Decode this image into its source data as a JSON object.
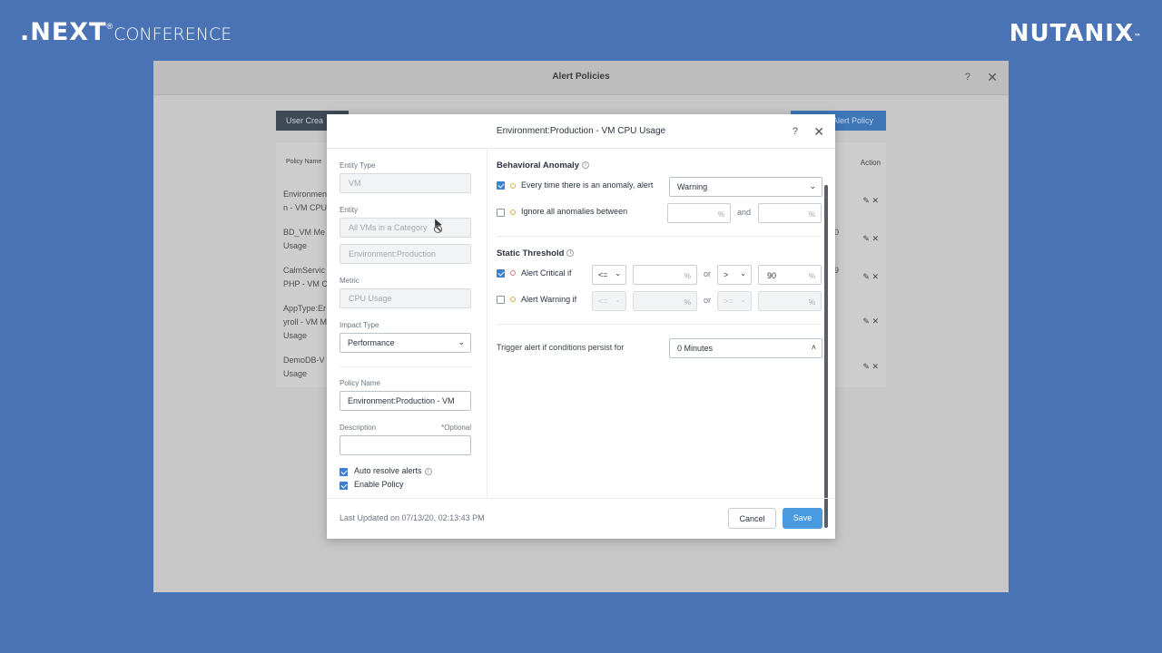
{
  "branding": {
    "next_text": ".NEXT",
    "next_reg": "®",
    "conference_text": "CONFERENCE",
    "nutanix_text": "NUTANIX",
    "nutanix_tm": "™"
  },
  "background_window": {
    "title": "Alert Policies",
    "help": "?",
    "close": "✕",
    "tab_label": "User Crea",
    "create_label": "Alert Policy",
    "col_policy_name": "Policy Name",
    "col_action": "Action",
    "rows": [
      {
        "line1": "Environmen",
        "line2": "n - VM CPU"
      },
      {
        "line1": "BD_VM Me",
        "line2": "Usage"
      },
      {
        "line1": "CalmServic",
        "line2": "PHP - VM C"
      },
      {
        "line1": "AppType:Er",
        "line2": "yroll - VM M",
        "line3": "Usage"
      },
      {
        "line1": "DemoDB-V",
        "line2": "Usage"
      }
    ],
    "row_stubs": [
      "0",
      "9"
    ]
  },
  "modal": {
    "title": "Environment:Production - VM CPU Usage",
    "help": "?",
    "close": "✕",
    "entity_type": {
      "label": "Entity Type",
      "value": "VM"
    },
    "entity": {
      "label": "Entity",
      "value": "All VMs in a Category",
      "category": "Environment:Production"
    },
    "metric": {
      "label": "Metric",
      "value": "CPU Usage"
    },
    "impact_type": {
      "label": "Impact Type",
      "value": "Performance"
    },
    "policy_name": {
      "label": "Policy Name",
      "value": "Environment:Production - VM"
    },
    "description": {
      "label": "Description",
      "optional": "*Optional",
      "value": ""
    },
    "auto_resolve": {
      "label": "Auto resolve alerts",
      "checked": true
    },
    "enable_policy": {
      "label": "Enable Policy",
      "checked": true
    },
    "behavioral_anomaly": {
      "title": "Behavioral Anomaly",
      "every_time_label": "Every time there is an anomaly, alert",
      "every_time_checked": true,
      "severity": "Warning",
      "ignore_label": "Ignore all anomalies between",
      "ignore_checked": false,
      "and_label": "and",
      "pct": "%"
    },
    "static_threshold": {
      "title": "Static Threshold",
      "critical_label": "Alert Critical if",
      "critical_checked": true,
      "critical_op1": "<=",
      "critical_or": "or",
      "critical_op2": ">",
      "critical_value": "90",
      "warning_label": "Alert Warning if",
      "warning_checked": false,
      "warning_op1": "<=",
      "warning_or": "or",
      "warning_op2": ">=",
      "pct": "%"
    },
    "trigger": {
      "label": "Trigger alert if conditions persist for",
      "value": "0 Minutes"
    },
    "last_updated": "Last Updated on 07/13/20, 02:13:43 PM",
    "cancel_label": "Cancel",
    "save_label": "Save"
  },
  "colors": {
    "background": "#4a73b6",
    "primary": "#4a9ae0",
    "checkbox": "#3c7fcf"
  }
}
